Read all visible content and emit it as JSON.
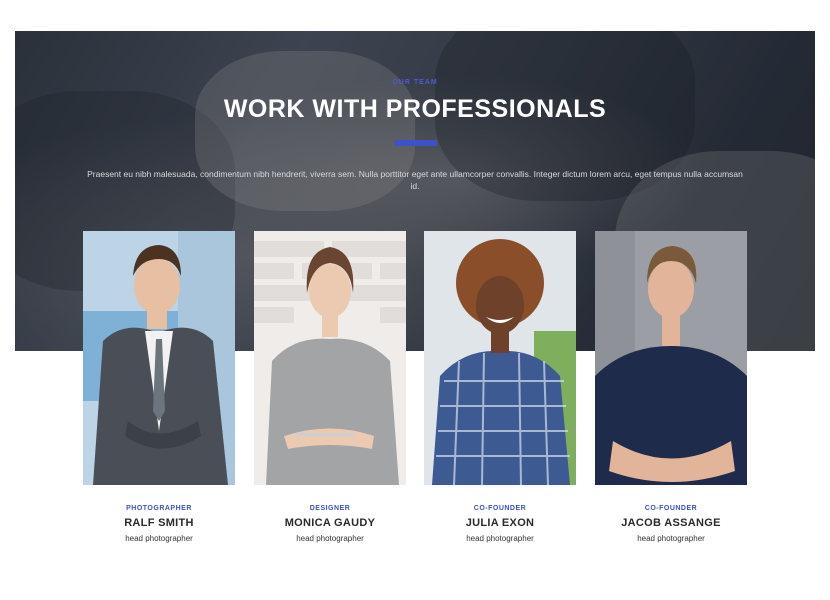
{
  "hero": {
    "eyebrow": "OUR TEAM",
    "title": "WORK WITH PROFESSIONALS",
    "text": "Praesent eu nibh malesuada, condimentum nibh hendrerit, viverra sem. Nulla porttitor eget ante ullamcorper convallis. Integer dictum lorem arcu, eget tempus nulla accumsan id.",
    "accent_color": "#3f51c7"
  },
  "team": [
    {
      "role": "PHOTOGRAPHER",
      "name": "RALF SMITH",
      "subtitle": "head photographer",
      "photo": "man-in-suit-photo"
    },
    {
      "role": "DESIGNER",
      "name": "MONICA GAUDY",
      "subtitle": "head photographer",
      "photo": "woman-in-grey-dress-photo"
    },
    {
      "role": "CO-FOUNDER",
      "name": "JULIA EXON",
      "subtitle": "head photographer",
      "photo": "woman-in-plaid-shirt-photo"
    },
    {
      "role": "CO-FOUNDER",
      "name": "JACOB ASSANGE",
      "subtitle": "head photographer",
      "photo": "man-in-navy-tshirt-photo"
    }
  ]
}
